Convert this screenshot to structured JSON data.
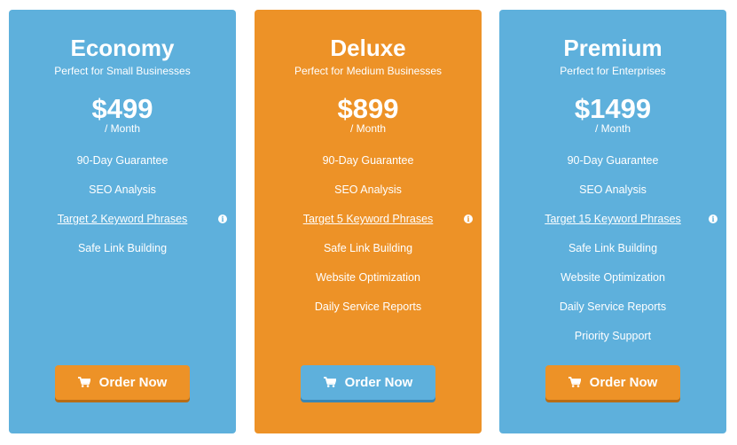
{
  "plans": [
    {
      "name": "Economy",
      "subtitle": "Perfect for Small Businesses",
      "price": "$499",
      "period": "/ Month",
      "features": [
        {
          "text": "90-Day Guarantee"
        },
        {
          "text": "SEO Analysis"
        },
        {
          "text": "Target 2 Keyword Phrases",
          "info_icon": "info-icon"
        },
        {
          "text": "Safe Link Building"
        }
      ],
      "button": {
        "label": "Order Now",
        "icon": "cart-icon",
        "color": "#ed9227"
      },
      "color": "#5eb0dc"
    },
    {
      "name": "Deluxe",
      "subtitle": "Perfect for Medium Businesses",
      "price": "$899",
      "period": "/ Month",
      "features": [
        {
          "text": "90-Day Guarantee"
        },
        {
          "text": "SEO Analysis"
        },
        {
          "text": "Target 5 Keyword Phrases",
          "info_icon": "info-icon"
        },
        {
          "text": "Safe Link Building"
        },
        {
          "text": "Website Optimization"
        },
        {
          "text": "Daily Service Reports"
        }
      ],
      "button": {
        "label": "Order Now",
        "icon": "cart-icon",
        "color": "#5eb0dc"
      },
      "color": "#ed9227"
    },
    {
      "name": "Premium",
      "subtitle": "Perfect for Enterprises",
      "price": "$1499",
      "period": "/ Month",
      "features": [
        {
          "text": "90-Day Guarantee"
        },
        {
          "text": "SEO Analysis"
        },
        {
          "text": "Target 15 Keyword Phrases",
          "info_icon": "info-icon"
        },
        {
          "text": "Safe Link Building"
        },
        {
          "text": "Website Optimization"
        },
        {
          "text": "Daily Service Reports"
        },
        {
          "text": "Priority Support"
        }
      ],
      "button": {
        "label": "Order Now",
        "icon": "cart-icon",
        "color": "#ed9227"
      },
      "color": "#5eb0dc"
    }
  ]
}
